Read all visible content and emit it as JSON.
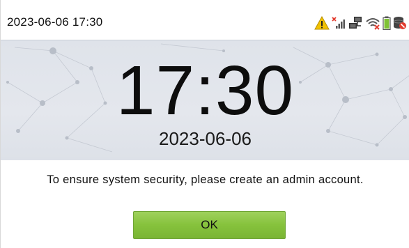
{
  "status_bar": {
    "datetime": "2023-06-06 17:30",
    "icons": [
      "warning-icon",
      "no-signal-icon",
      "network-icon",
      "wifi-off-icon",
      "battery-icon",
      "database-icon"
    ]
  },
  "clock": {
    "time": "17:30",
    "date": "2023-06-06"
  },
  "dialog": {
    "message": "To ensure system security, please create an admin account.",
    "ok_label": "OK"
  },
  "colors": {
    "button_green": "#86c23c",
    "warning_yellow": "#f2c200",
    "alert_red": "#e23b2e"
  }
}
